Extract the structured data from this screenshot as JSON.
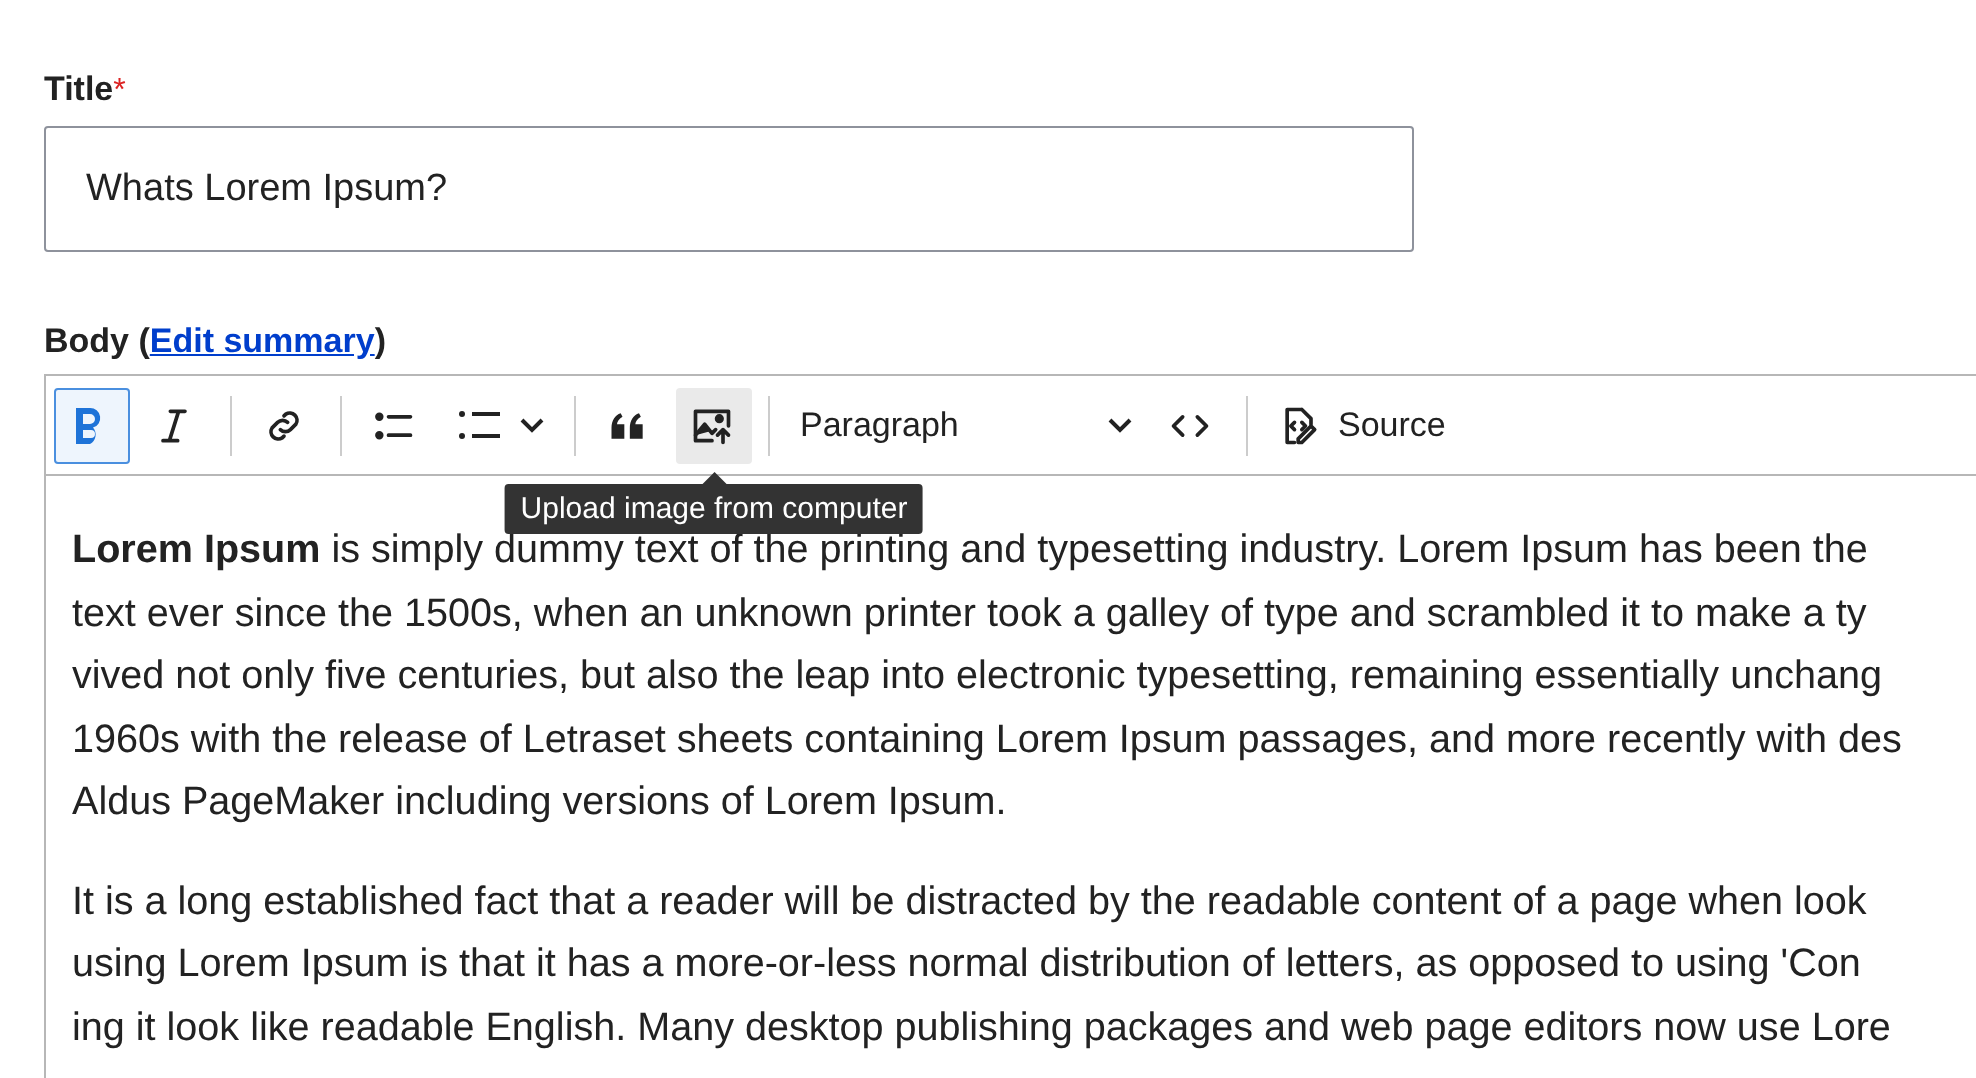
{
  "title_field": {
    "label": "Title",
    "required_mark": "*",
    "value": "Whats Lorem Ipsum?"
  },
  "body_field": {
    "label": "Body (",
    "link": "Edit summary",
    "label_end": ")",
    "toolbar": [
      {
        "kind": "bold",
        "active": true,
        "hovered": false
      },
      {
        "kind": "italic",
        "active": false,
        "hovered": false
      },
      {
        "kind": "separator"
      },
      {
        "kind": "link",
        "active": false,
        "hovered": false
      },
      {
        "kind": "separator"
      },
      {
        "kind": "bullet-list",
        "active": false,
        "hovered": false
      },
      {
        "kind": "numbered-list",
        "active": false,
        "hovered": false
      },
      {
        "kind": "separator"
      },
      {
        "kind": "blockquote",
        "active": false,
        "hovered": false
      },
      {
        "kind": "image",
        "active": false,
        "hovered": true
      },
      {
        "kind": "separator"
      },
      {
        "kind": "heading",
        "label": "Paragraph"
      },
      {
        "kind": "code",
        "active": false,
        "hovered": false
      },
      {
        "kind": "separator"
      },
      {
        "kind": "source",
        "active": false,
        "hovered": false,
        "label": "Source"
      }
    ],
    "tooltip": "Upload image from computer",
    "paragraphs": [
      {
        "lines": [
          "**Lorem Ipsum** is simply dummy text of the printing and typesetting industry. Lorem Ipsum has been the",
          "text ever since the 1500s, when an unknown printer took a galley of type and scrambled it to make a ty",
          "vived not only five centuries, but also the leap into electronic typesetting, remaining essentially unchang",
          "1960s with the release of Letraset sheets containing Lorem Ipsum passages, and more recently with des",
          "Aldus PageMaker including versions of Lorem Ipsum."
        ]
      },
      {
        "lines": [
          "It is a long established fact that a reader will be distracted by the readable content of a page when look",
          "using Lorem Ipsum is that it has a more-or-less normal distribution of letters, as opposed to using 'Con",
          "ing it look like readable English. Many desktop publishing packages and web page editors now use Lore"
        ]
      }
    ]
  }
}
